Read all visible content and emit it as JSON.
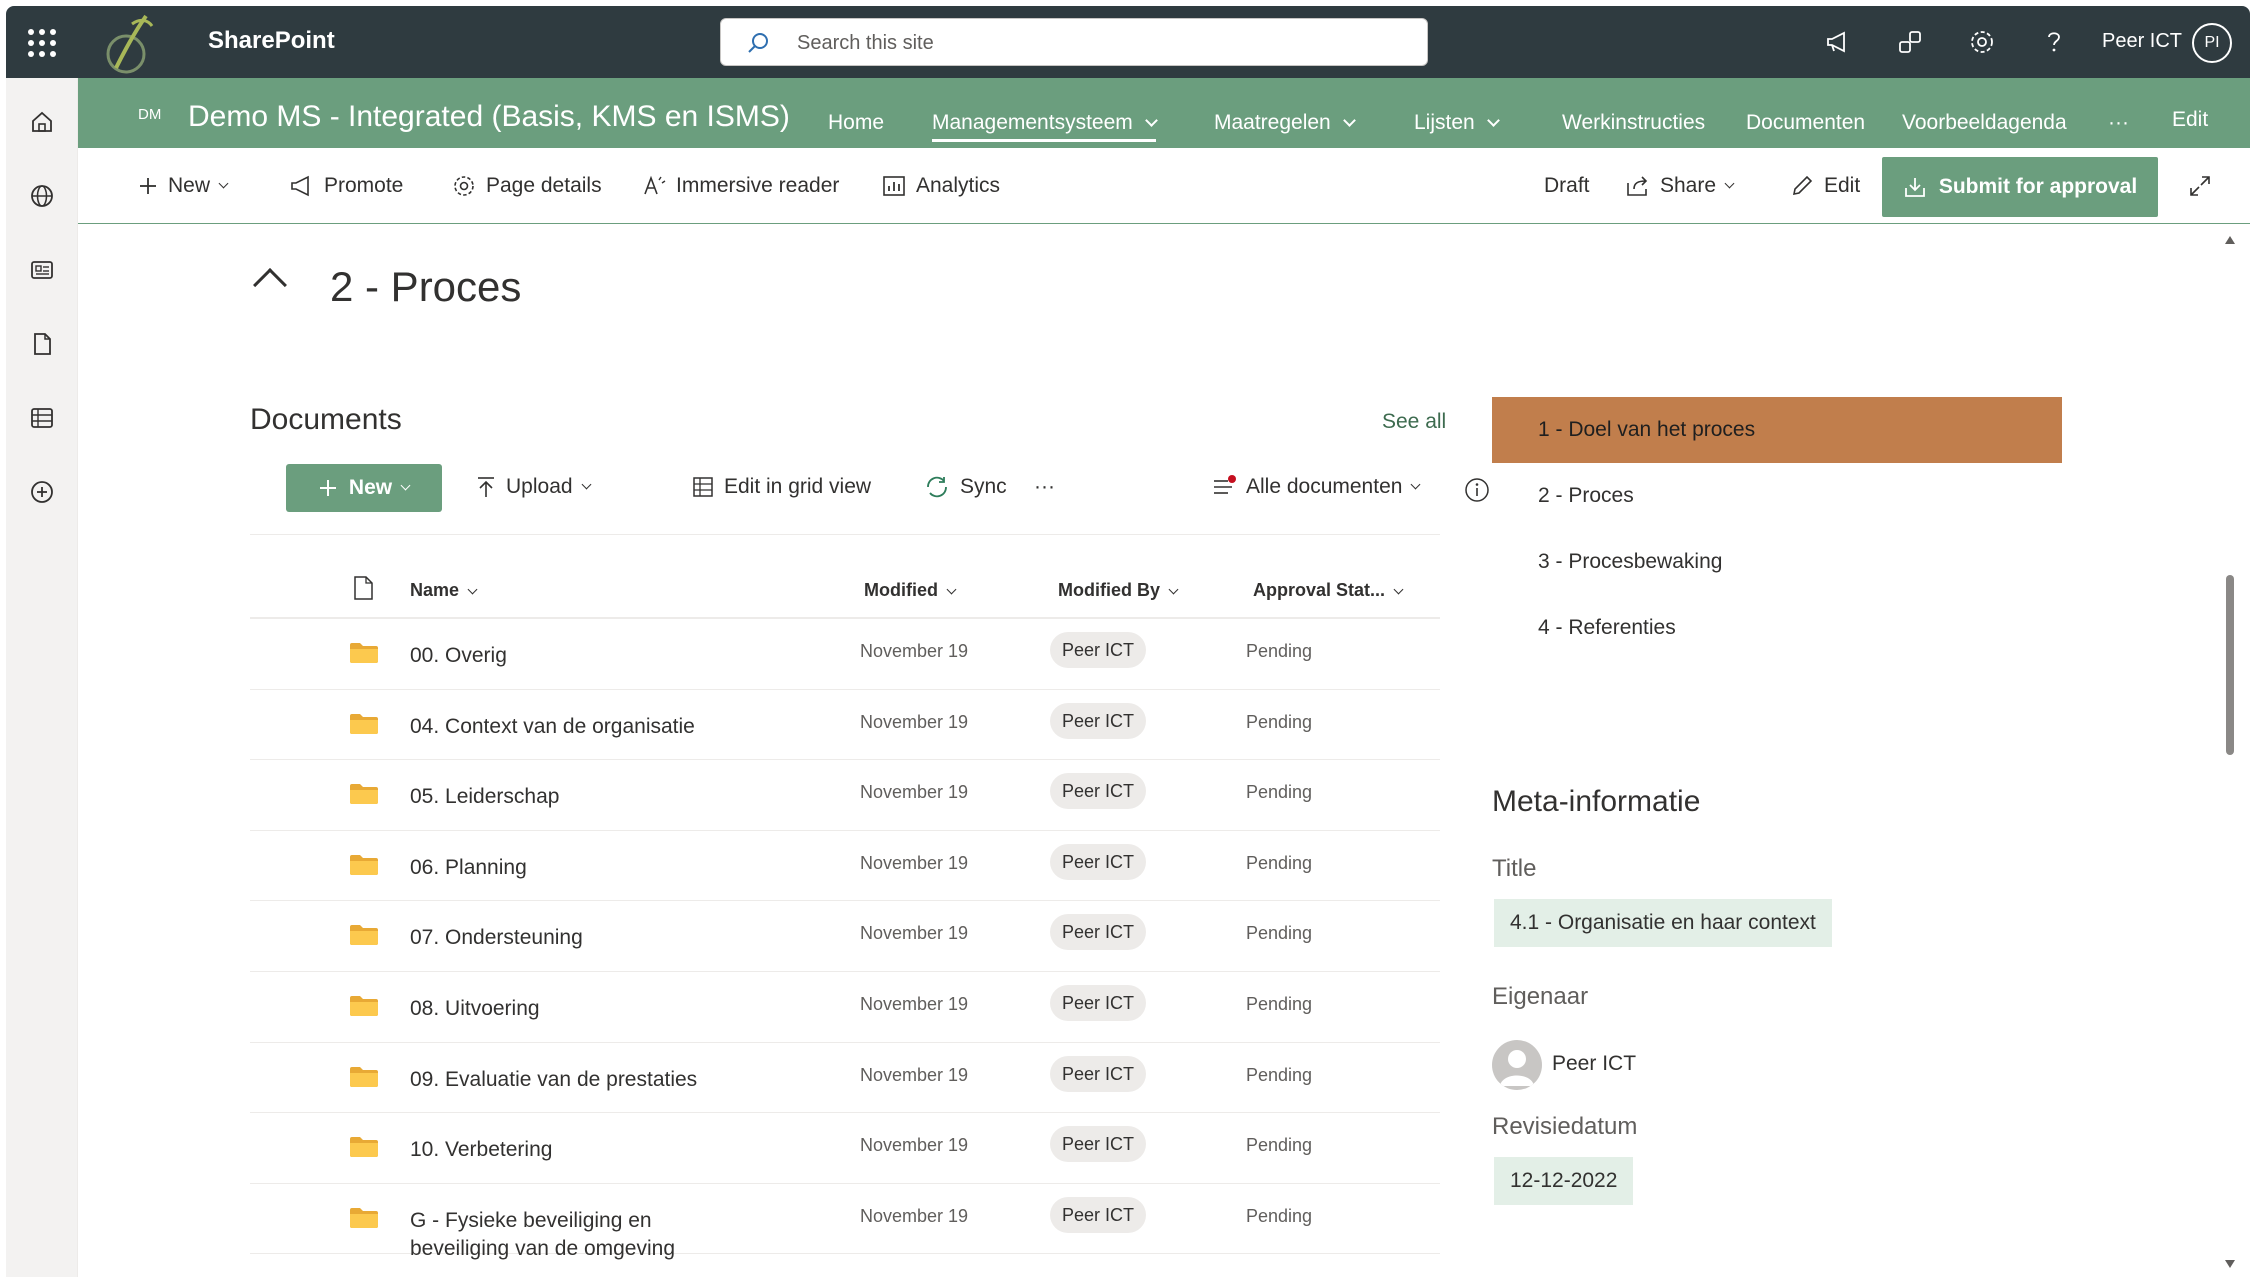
{
  "suitebar": {
    "brand": "SharePoint",
    "search_placeholder": "Search this site",
    "user_name": "Peer ICT",
    "user_initials": "PI"
  },
  "site": {
    "initials": "DM",
    "title": "Demo MS - Integrated (Basis, KMS en ISMS)",
    "nav": [
      {
        "label": "Home"
      },
      {
        "label": "Managementsysteem"
      },
      {
        "label": "Maatregelen"
      },
      {
        "label": "Lijsten"
      },
      {
        "label": "Werkinstructies"
      },
      {
        "label": "Documenten"
      },
      {
        "label": "Voorbeeldagenda"
      },
      {
        "label": "···"
      },
      {
        "label": "Edit"
      }
    ]
  },
  "commandbar": {
    "new": "New",
    "promote": "Promote",
    "page_details": "Page details",
    "immersive_reader": "Immersive reader",
    "analytics": "Analytics",
    "draft": "Draft",
    "share": "Share",
    "edit": "Edit",
    "submit": "Submit for approval"
  },
  "section": {
    "title": "2 - Proces"
  },
  "documents": {
    "title": "Documents",
    "see_all": "See all",
    "toolbar": {
      "new": "New",
      "upload": "Upload",
      "edit_grid": "Edit in grid view",
      "sync": "Sync",
      "more": "···",
      "view": "Alle documenten"
    },
    "columns": {
      "name": "Name",
      "modified": "Modified",
      "modified_by": "Modified By",
      "approval": "Approval Stat..."
    },
    "rows": [
      {
        "name": "00. Overig",
        "modified": "November 19",
        "by": "Peer ICT",
        "status": "Pending"
      },
      {
        "name": "04. Context van de organisatie",
        "modified": "November 19",
        "by": "Peer ICT",
        "status": "Pending"
      },
      {
        "name": "05. Leiderschap",
        "modified": "November 19",
        "by": "Peer ICT",
        "status": "Pending"
      },
      {
        "name": "06. Planning",
        "modified": "November 19",
        "by": "Peer ICT",
        "status": "Pending"
      },
      {
        "name": "07. Ondersteuning",
        "modified": "November 19",
        "by": "Peer ICT",
        "status": "Pending"
      },
      {
        "name": "08. Uitvoering",
        "modified": "November 19",
        "by": "Peer ICT",
        "status": "Pending"
      },
      {
        "name": "09. Evaluatie van de prestaties",
        "modified": "November 19",
        "by": "Peer ICT",
        "status": "Pending"
      },
      {
        "name": "10. Verbetering",
        "modified": "November 19",
        "by": "Peer ICT",
        "status": "Pending"
      },
      {
        "name": "G - Fysieke beveiliging en beveiliging van de omgeving",
        "modified": "November 19",
        "by": "Peer ICT",
        "status": "Pending"
      }
    ]
  },
  "toc": [
    {
      "label": "1 - Doel van het proces"
    },
    {
      "label": "2 - Proces"
    },
    {
      "label": "3 - Procesbewaking"
    },
    {
      "label": "4 - Referenties"
    }
  ],
  "meta": {
    "title": "Meta-informatie",
    "title_label": "Title",
    "title_value": "4.1 - Organisatie en haar context",
    "owner_label": "Eigenaar",
    "owner_name": "Peer ICT",
    "revision_label": "Revisiedatum",
    "revision_value": "12-12-2022"
  },
  "colors": {
    "suitebar": "#2f3b40",
    "site_header": "#6b9e7e",
    "accent": "#6b9e7e",
    "toc_active": "#c17e4c",
    "meta_value_bg": "#e3efe7"
  }
}
